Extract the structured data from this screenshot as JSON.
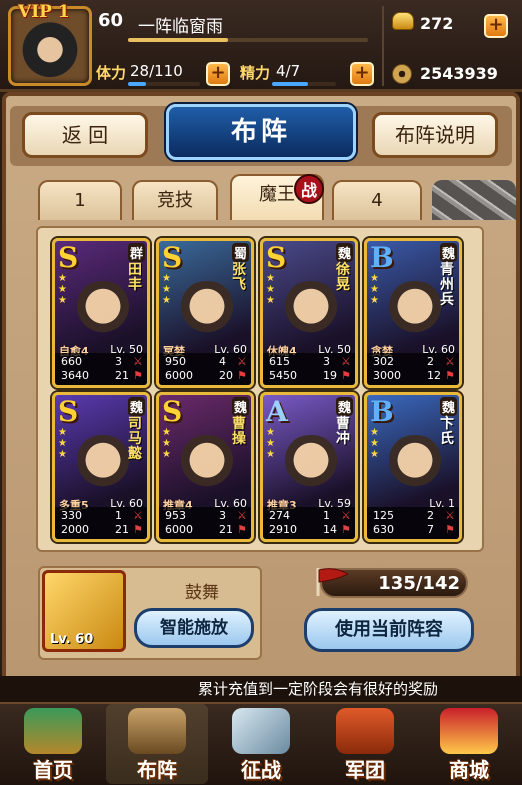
{
  "header": {
    "vip": "VIP 1",
    "level": "60",
    "player_name": "一阵临窗雨",
    "stamina_label": "体力",
    "stamina_value": "28/110",
    "stamina_fill": 0.25,
    "energy_label": "精力",
    "energy_value": "4/7",
    "energy_fill": 0.57,
    "plus": "+",
    "gold": "272",
    "coins": "2543939"
  },
  "nav": {
    "back": "返 回",
    "title": "布阵",
    "help": "布阵说明"
  },
  "tabs": [
    {
      "label": "1"
    },
    {
      "label": "竞技"
    },
    {
      "label": "魔王"
    },
    {
      "label": "4"
    }
  ],
  "tab_badge": "战",
  "heroes": [
    {
      "grade": "S",
      "faction": "群",
      "name": "田丰",
      "skill": "自愈4",
      "level": "Lv. 50",
      "atk": "660",
      "atk_n": "3",
      "hp": "3640",
      "hp_n": "21",
      "color": "#5a2a7a"
    },
    {
      "grade": "S",
      "faction": "蜀",
      "name": "张飞",
      "skill": "冥婪",
      "level": "Lv. 60",
      "atk": "950",
      "atk_n": "4",
      "hp": "6000",
      "hp_n": "20",
      "color": "#3a6a9a"
    },
    {
      "grade": "S",
      "faction": "魏",
      "name": "徐晃",
      "skill": "休魄4",
      "level": "Lv. 50",
      "atk": "615",
      "atk_n": "3",
      "hp": "5450",
      "hp_n": "19",
      "color": "#4a4a8a"
    },
    {
      "grade": "B",
      "faction": "魏",
      "name": "青州兵",
      "skill": "贪婪",
      "level": "Lv. 60",
      "atk": "302",
      "atk_n": "2",
      "hp": "3000",
      "hp_n": "12",
      "color": "#3a5aa8"
    },
    {
      "grade": "S",
      "faction": "魏",
      "name": "司马懿",
      "skill": "多重5",
      "level": "Lv. 60",
      "atk": "330",
      "atk_n": "1",
      "hp": "2000",
      "hp_n": "21",
      "color": "#5a3ab0"
    },
    {
      "grade": "S",
      "faction": "魏",
      "name": "曹操",
      "skill": "推章4",
      "level": "Lv. 60",
      "atk": "953",
      "atk_n": "3",
      "hp": "6000",
      "hp_n": "21",
      "color": "#6a2a6a"
    },
    {
      "grade": "A",
      "faction": "魏",
      "name": "曹冲",
      "skill": "推章3",
      "level": "Lv. 59",
      "atk": "274",
      "atk_n": "1",
      "hp": "2910",
      "hp_n": "14",
      "color": "#7a5ac8"
    },
    {
      "grade": "B",
      "faction": "魏",
      "name": "卞氏",
      "skill": "",
      "level": "Lv. 1",
      "atk": "125",
      "atk_n": "2",
      "hp": "630",
      "hp_n": "7",
      "color": "#3a6ac0"
    }
  ],
  "skill_panel": {
    "scroll_level": "Lv. 60",
    "skill_name": "鼓舞",
    "auto_cast": "智能施放"
  },
  "cost": "135/142",
  "use_formation": "使用当前阵容",
  "ticker": "累计充值到一定阶段会有很好的奖励",
  "bottom_nav": [
    {
      "label": "首页"
    },
    {
      "label": "布阵"
    },
    {
      "label": "征战"
    },
    {
      "label": "军团"
    },
    {
      "label": "商城"
    }
  ],
  "colors": {
    "accent_orange": "#e07a12",
    "title_blue": "#0b2b60",
    "card_border_gold": "#e8b93a"
  }
}
